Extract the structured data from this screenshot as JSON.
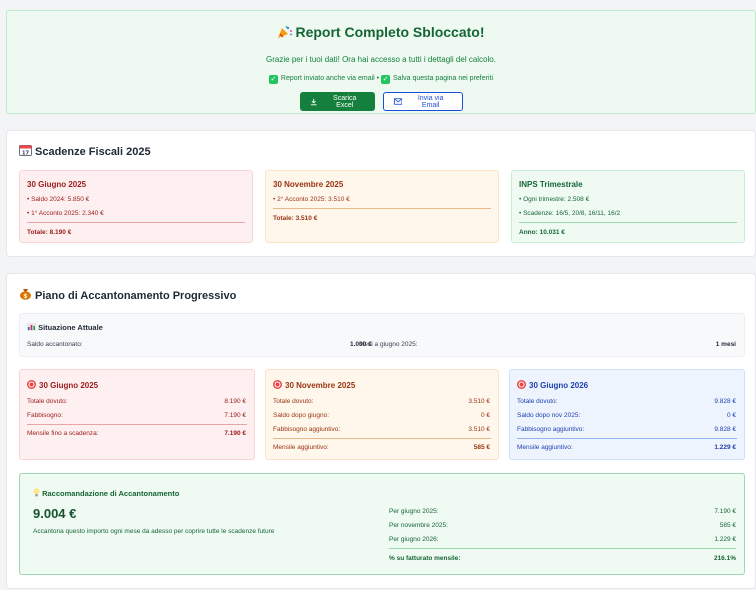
{
  "banner": {
    "icon": "party-popper-icon",
    "title": "Report Completo Sbloccato!",
    "subtitle": "Grazie per i tuoi dati! Ora hai accesso a tutti i dettagli del calcolo.",
    "check1": "Report inviato anche via email",
    "separator": "•",
    "check2": "Salva questa pagina nei preferiti",
    "excel_button": "Scarica Excel",
    "email_button": "Invia via Email"
  },
  "deadlines": {
    "icon": "calendar-icon",
    "title": "Scadenze Fiscali 2025",
    "cards": [
      {
        "title": "30 Giugno 2025",
        "lines": [
          "• Saldo 2024: 5.850 €",
          "• 1° Acconto 2025: 2.340 €"
        ],
        "total": "Totale: 8.190 €"
      },
      {
        "title": "30 Novembre 2025",
        "lines": [
          "• 2° Acconto 2025: 3.510 €"
        ],
        "total": "Totale: 3.510 €"
      },
      {
        "title": "INPS Trimestrale",
        "lines": [
          "• Ogni trimestre: 2.508 €",
          "• Scadenze: 16/5, 20/8, 16/11, 16/2"
        ],
        "total": "Anno: 10.031 €"
      }
    ]
  },
  "plan": {
    "icon": "money-bag-icon",
    "title": "Piano di Accantonamento Progressivo",
    "situation": {
      "icon": "chart-icon",
      "title": "Situazione Attuale",
      "saldo_label": "Saldo accantonato:",
      "saldo_value": "1.000 €",
      "mesi_label": "Mesi a giugno 2025:",
      "mesi_value": "1 mesi"
    },
    "targets": [
      {
        "title": "30 Giugno 2025",
        "rows": [
          [
            "Totale dovuto:",
            "8.190 €"
          ],
          [
            "Fabbisogno:",
            "7.190 €"
          ]
        ],
        "summary_label": "Mensile fino a scadenza:",
        "summary_value": "7.190 €"
      },
      {
        "title": "30 Novembre 2025",
        "rows": [
          [
            "Totale dovuto:",
            "3.510 €"
          ],
          [
            "Saldo dopo giugno:",
            "0 €"
          ],
          [
            "Fabbisogno aggiuntivo:",
            "3.510 €"
          ]
        ],
        "summary_label": "Mensile aggiuntivo:",
        "summary_value": "585 €"
      },
      {
        "title": "30 Giugno 2026",
        "rows": [
          [
            "Totale dovuto:",
            "9.828 €"
          ],
          [
            "Saldo dopo nov 2025:",
            "0 €"
          ],
          [
            "Fabbisogno aggiuntivo:",
            "9.828 €"
          ]
        ],
        "summary_label": "Mensile aggiuntivo:",
        "summary_value": "1.229 €"
      }
    ],
    "recommendation": {
      "icon": "lightbulb-icon",
      "title": "Raccomandazione di Accantonamento",
      "amount": "9.004 €",
      "description": "Accantona questo importo ogni mese da adesso per coprire tutte le scadenze future",
      "rows": [
        [
          "Per giugno 2025:",
          "7.190 €"
        ],
        [
          "Per novembre 2025:",
          "585 €"
        ],
        [
          "Per giugno 2026:",
          "1.229 €"
        ]
      ],
      "pct_label": "% su fatturato mensile:",
      "pct_value": "216.1%"
    }
  }
}
